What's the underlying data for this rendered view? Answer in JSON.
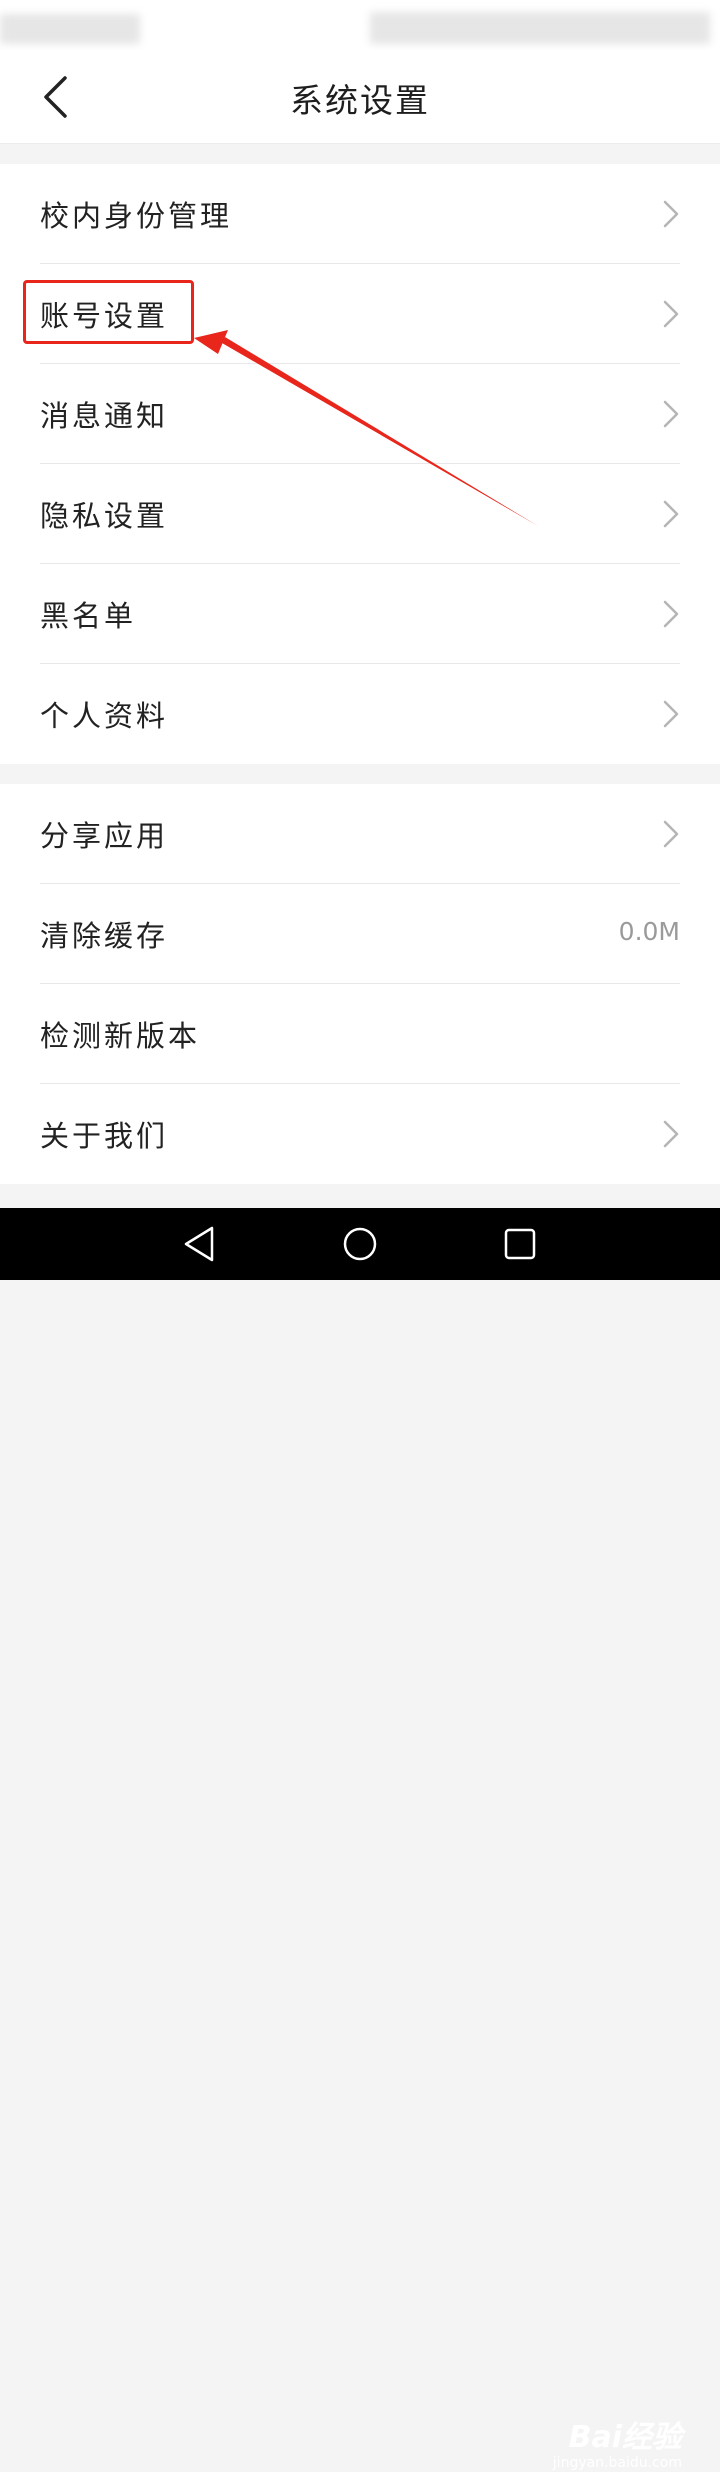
{
  "header": {
    "title": "系统设置"
  },
  "group1": {
    "items": [
      {
        "label": "校内身份管理"
      },
      {
        "label": "账号设置"
      },
      {
        "label": "消息通知"
      },
      {
        "label": "隐私设置"
      },
      {
        "label": "黑名单"
      },
      {
        "label": "个人资料"
      }
    ]
  },
  "group2": {
    "items": [
      {
        "label": "分享应用"
      },
      {
        "label": "清除缓存",
        "value": "0.0M"
      },
      {
        "label": "检测新版本"
      },
      {
        "label": "关于我们"
      }
    ]
  },
  "watermark": {
    "logo": "Bai经验",
    "url": "jingyan.baidu.com"
  },
  "icons": {
    "back": "back-arrow-icon",
    "chevron": "chevron-right-icon",
    "nav": [
      "nav-back-icon",
      "nav-home-icon",
      "nav-recents-icon"
    ]
  },
  "colors": {
    "annotation": "#e8261c",
    "chevron": "#b5b5b5",
    "value": "#9a9a9a"
  }
}
